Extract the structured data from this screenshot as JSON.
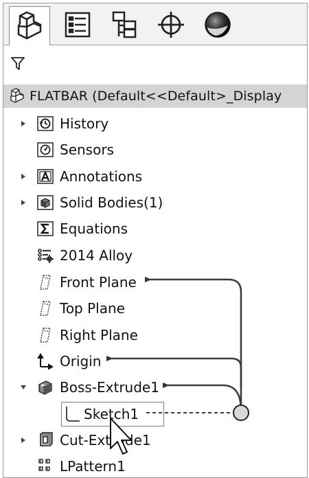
{
  "root": {
    "label": "FLATBAR  (Default<<Default>_Display"
  },
  "tabs": [
    {
      "name": "featuremanager-tab-icon",
      "active": true
    },
    {
      "name": "propertymanager-tab-icon"
    },
    {
      "name": "configurationmanager-tab-icon"
    },
    {
      "name": "dimxpertmanager-tab-icon"
    },
    {
      "name": "displaymanager-tab-icon"
    }
  ],
  "tree": [
    {
      "label": "History",
      "icon": "history-icon",
      "expandable": true
    },
    {
      "label": "Sensors",
      "icon": "sensors-icon",
      "expandable": false
    },
    {
      "label": "Annotations",
      "icon": "annotations-icon",
      "expandable": true
    },
    {
      "label": "Solid Bodies(1)",
      "icon": "solid-bodies-icon",
      "expandable": true
    },
    {
      "label": "Equations",
      "icon": "equations-icon",
      "expandable": false
    },
    {
      "label": "2014 Alloy",
      "icon": "material-icon",
      "expandable": false
    },
    {
      "label": "Front Plane",
      "icon": "plane-icon",
      "expandable": false
    },
    {
      "label": "Top Plane",
      "icon": "plane-icon",
      "expandable": false
    },
    {
      "label": "Right Plane",
      "icon": "plane-icon",
      "expandable": false
    },
    {
      "label": "Origin",
      "icon": "origin-icon",
      "expandable": false
    },
    {
      "label": "Boss-Extrude1",
      "icon": "boss-extrude-icon",
      "expandable": true,
      "expanded": true
    },
    {
      "label": "Sketch1",
      "icon": "sketch-icon",
      "expandable": false
    },
    {
      "label": "Cut-Extrude1",
      "icon": "cut-extrude-icon",
      "expandable": true
    },
    {
      "label": "LPattern1",
      "icon": "linear-pattern-icon",
      "expandable": false
    }
  ]
}
